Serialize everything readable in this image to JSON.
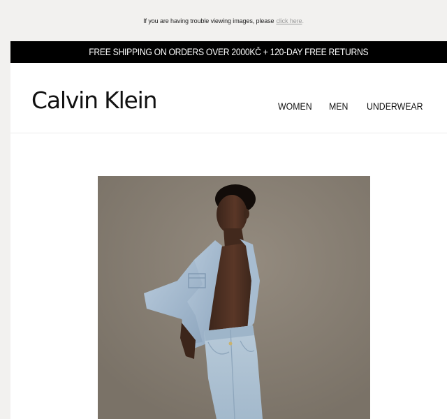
{
  "preheader": {
    "text": "If you are having trouble viewing images, please",
    "link_label": "click here",
    "punctuation": "."
  },
  "promo": {
    "text": "FREE SHIPPING ON ORDERS OVER 2000KČ + 120-DAY FREE RETURNS"
  },
  "header": {
    "logo": "Calvin Klein",
    "nav": {
      "women": "WOMEN",
      "men": "MEN",
      "underwear": "UNDERWEAR"
    }
  },
  "colors": {
    "page_background": "#f2f1ef",
    "promo_background": "#000000",
    "hero_background": "#847b70",
    "denim": "#a9bfd3"
  }
}
